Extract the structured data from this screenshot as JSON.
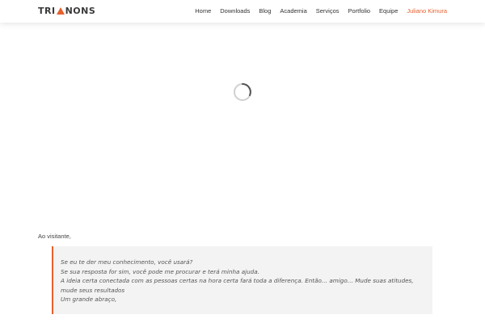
{
  "header": {
    "logo": {
      "left": "TRI",
      "right": "NONS"
    },
    "nav": [
      {
        "label": "Home"
      },
      {
        "label": "Downloads"
      },
      {
        "label": "Blog"
      },
      {
        "label": "Academia"
      },
      {
        "label": "Serviços"
      },
      {
        "label": "Portfolio"
      },
      {
        "label": "Equipe"
      },
      {
        "label": "Juliano Kimura"
      }
    ]
  },
  "content": {
    "greeting": "Ao visitante,",
    "quote_lines": [
      "Se eu te der meu conhecimento, você usará?",
      "Se sua resposta for sim, você pode me procurar e terá minha ajuda.",
      "A ideia certa conectada com as pessoas certas na hora certa fará toda a diferença. Então… amigo… Mude suas atitudes, mude seus resultados",
      "Um grande abraço,"
    ]
  },
  "colors": {
    "accent": "#e6602e",
    "spinner_track": "#d0d0d0",
    "spinner_arc": "#555555",
    "quote_background": "#f3f3f3"
  },
  "icons": {
    "logo_mark": "triangle",
    "loading": "loading-spinner"
  }
}
